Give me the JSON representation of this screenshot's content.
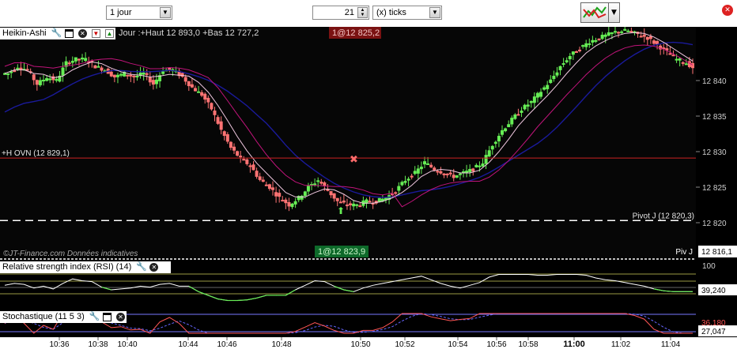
{
  "toolbar": {
    "timeframe_value": "1 jour",
    "ticks_count": "21",
    "ticks_unit": "(x) ticks",
    "indicator_icon": "chart-indicators-icon",
    "dropdown_icon": "chevron-down-icon",
    "close_icon": "close-icon"
  },
  "main_panel": {
    "title": "Heikin-Ashi",
    "icons": [
      "wrench-icon",
      "window-icon",
      "close-icon",
      "arrow-down-icon",
      "arrow-up-icon"
    ],
    "day_info": "Jour :+Haut 12 893,0 +Bas 12 727,2",
    "order_top": "1@12 825,2",
    "order_bottom": "1@12 823,9",
    "h_ovn_label": "+H OVN (12 829,1)",
    "pivot_label": "Pivot J (12 820,3)",
    "piv_short": "Piv J",
    "watermark": "©JT-Finance.com Données indicatives",
    "price_axis": [
      "12 840",
      "12 835",
      "12 830",
      "12 825",
      "12 820"
    ],
    "current_price": "12 816,1",
    "colors": {
      "up": "#66ee55",
      "down": "#ff7373",
      "h_ovn": "#cc2222",
      "ma_slow": "#1a1a9a",
      "ma_fast": "#f0c8e0",
      "ma_mid": "#c0147a"
    }
  },
  "rsi_panel": {
    "title": "Relative strength index (RSI) (14)",
    "icons": [
      "wrench-icon",
      "close-icon"
    ],
    "axis_top": "100",
    "value": "39,240",
    "colors": {
      "line": "#ffffff",
      "low": "#66ee55",
      "level": "#cccc55"
    }
  },
  "stoch_panel": {
    "title": "Stochastique (11 5 3)",
    "icons": [
      "wrench-icon",
      "window-icon",
      "close-icon"
    ],
    "value_k": "36,180",
    "value_d": "27,047",
    "colors": {
      "k": "#ff5555",
      "d": "#6666ff"
    }
  },
  "time_axis": [
    "10:36",
    "10:38",
    "10:40",
    "10:44",
    "10:46",
    "10:48",
    "10:50",
    "10:52",
    "10:54",
    "10:56",
    "10:58",
    "11:00",
    "11:02",
    "11:04"
  ],
  "time_axis_bold": "11:00",
  "chart_data": {
    "type": "candlestick",
    "style": "Heikin-Ashi",
    "timeframe": "21 ticks",
    "y_axis_ticks": [
      12840,
      12835,
      12830,
      12825,
      12820
    ],
    "current_price": 12816.1,
    "levels": [
      {
        "label": "+H OVN (12 829,1)",
        "value": 12829.1
      },
      {
        "label": "Pivot J (12 820,3)",
        "value": 12820.3
      }
    ],
    "orders": [
      {
        "label": "1@12 825,2",
        "value": 12825.2
      },
      {
        "label": "1@12 823,9",
        "value": 12823.9
      }
    ],
    "day_high": 12893.0,
    "day_low": 12727.2,
    "price_path": [
      12841,
      12842,
      12841.5,
      12839.5,
      12840.5,
      12840,
      12842.5,
      12843,
      12843,
      12842,
      12841.5,
      12840.5,
      12841,
      12840.5,
      12841,
      12839.5,
      12841.5,
      12841.5,
      12840.5,
      12839,
      12838,
      12836,
      12833,
      12830.5,
      12829,
      12828,
      12826,
      12825,
      12823.5,
      12822.5,
      12823.5,
      12825,
      12826,
      12824.5,
      12823,
      12822.5,
      12822.5,
      12823,
      12823,
      12823.5,
      12824.5,
      12826,
      12827,
      12828.5,
      12827.5,
      12827,
      12826.5,
      12827,
      12827.5,
      12828.5,
      12831,
      12833,
      12834.5,
      12836,
      12837,
      12838.5,
      12840,
      12842,
      12843.5,
      12844.5,
      12845.5,
      12846,
      12846.5,
      12847,
      12847,
      12846.5,
      12846,
      12845,
      12844,
      12843,
      12842.5,
      12841.5
    ],
    "time_labels": [
      "10:36",
      "10:38",
      "10:40",
      "10:44",
      "10:46",
      "10:48",
      "10:50",
      "10:52",
      "10:54",
      "10:56",
      "10:58",
      "11:00",
      "11:02",
      "11:04"
    ],
    "rsi_levels_value": 39.24,
    "stoch_k": 36.18,
    "stoch_d": 27.047
  }
}
